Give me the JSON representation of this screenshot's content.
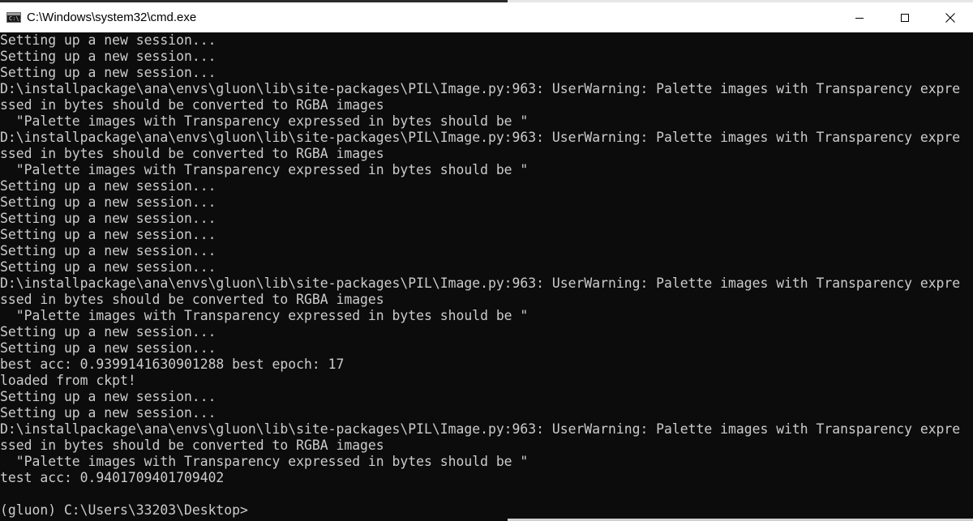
{
  "window": {
    "title": "C:\\Windows\\system32\\cmd.exe",
    "icon": "cmd-console-icon",
    "icon_glyph": "C:\\.",
    "controls": [
      "minimize-icon",
      "maximize-icon",
      "close-icon"
    ]
  },
  "console": {
    "lines": [
      "Setting up a new session...",
      "Setting up a new session...",
      "Setting up a new session...",
      "D:\\installpackage\\ana\\envs\\gluon\\lib\\site-packages\\PIL\\Image.py:963: UserWarning: Palette images with Transparency expre",
      "ssed in bytes should be converted to RGBA images",
      "  \"Palette images with Transparency expressed in bytes should be \"",
      "D:\\installpackage\\ana\\envs\\gluon\\lib\\site-packages\\PIL\\Image.py:963: UserWarning: Palette images with Transparency expre",
      "ssed in bytes should be converted to RGBA images",
      "  \"Palette images with Transparency expressed in bytes should be \"",
      "Setting up a new session...",
      "Setting up a new session...",
      "Setting up a new session...",
      "Setting up a new session...",
      "Setting up a new session...",
      "Setting up a new session...",
      "D:\\installpackage\\ana\\envs\\gluon\\lib\\site-packages\\PIL\\Image.py:963: UserWarning: Palette images with Transparency expre",
      "ssed in bytes should be converted to RGBA images",
      "  \"Palette images with Transparency expressed in bytes should be \"",
      "Setting up a new session...",
      "Setting up a new session...",
      "best acc: 0.9399141630901288 best epoch: 17",
      "loaded from ckpt!",
      "Setting up a new session...",
      "Setting up a new session...",
      "D:\\installpackage\\ana\\envs\\gluon\\lib\\site-packages\\PIL\\Image.py:963: UserWarning: Palette images with Transparency expre",
      "ssed in bytes should be converted to RGBA images",
      "  \"Palette images with Transparency expressed in bytes should be \"",
      "test acc: 0.9401709401709402"
    ],
    "prompt": "(gluon) C:\\Users\\33203\\Desktop>"
  },
  "colors": {
    "console_bg": "#0c0c0c",
    "console_text": "#cccccc",
    "titlebar_bg": "#ffffff"
  }
}
